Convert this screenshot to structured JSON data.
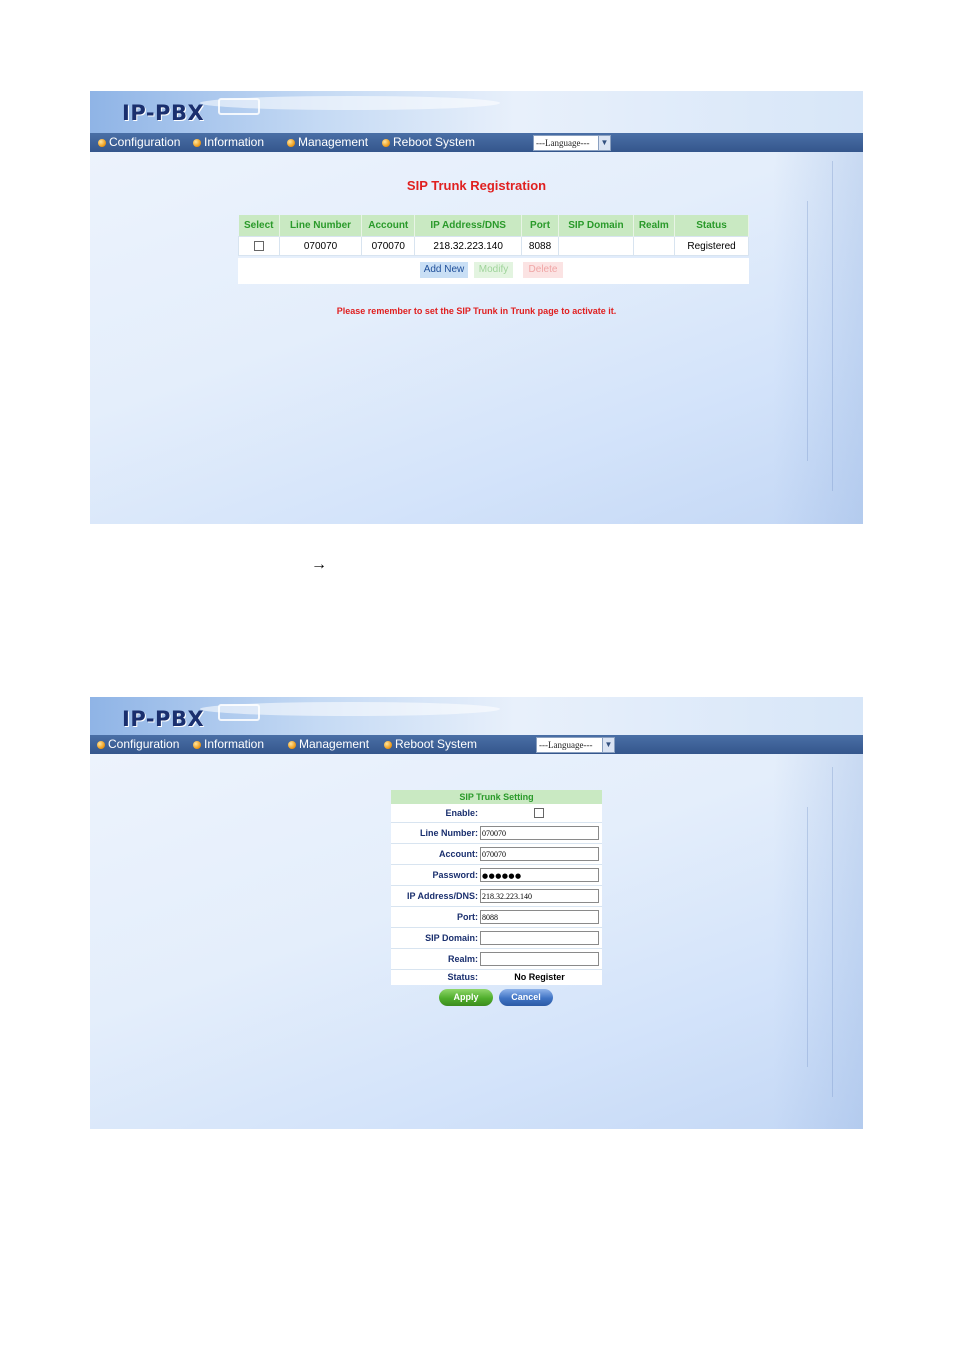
{
  "app": {
    "logo": "IP-PBX",
    "nav": [
      "Configuration",
      "Information",
      "Management",
      "Reboot System"
    ],
    "language_select": "---Language---"
  },
  "page1": {
    "title": "SIP Trunk Registration",
    "table": {
      "headers": [
        "Select",
        "Line Number",
        "Account",
        "IP Address/DNS",
        "Port",
        "SIP Domain",
        "Realm",
        "Status"
      ],
      "rows": [
        {
          "line_number": "070070",
          "account": "070070",
          "ip": "218.32.223.140",
          "port": "8088",
          "sip_domain": "",
          "realm": "",
          "status": "Registered"
        }
      ]
    },
    "buttons": {
      "add_new": "Add New",
      "modify": "Modify",
      "delete": "Delete"
    },
    "note": "Please remember to set the SIP Trunk in Trunk page to activate it."
  },
  "between": {
    "arrow": "→"
  },
  "page2": {
    "form_title": "SIP Trunk Setting",
    "labels": {
      "enable": "Enable:",
      "line_number": "Line Number:",
      "account": "Account:",
      "password": "Password:",
      "ip": "IP Address/DNS:",
      "port": "Port:",
      "sip_domain": "SIP Domain:",
      "realm": "Realm:",
      "status": "Status:"
    },
    "values": {
      "line_number": "070070",
      "account": "070070",
      "password": "●●●●●●",
      "ip": "218.32.223.140",
      "port": "8088",
      "sip_domain": "",
      "realm": "",
      "status": "No Register"
    },
    "buttons": {
      "apply": "Apply",
      "cancel": "Cancel"
    }
  },
  "colors": {
    "nav_bar": "#34568c",
    "title_red": "#e02020",
    "header_green": "#2a9a2a",
    "apply_green": "#4fae2c",
    "cancel_blue": "#3f73c4"
  }
}
